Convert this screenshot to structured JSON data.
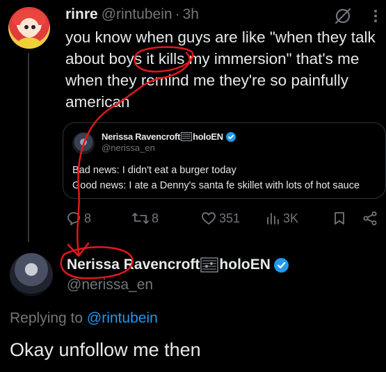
{
  "tweet": {
    "author_name": "rinre",
    "handle": "@rintubein",
    "separator": "·",
    "time": "3h",
    "text": "you know when guys are like \"when they talk about boys it kills my immersion\" that's me when they remind me they're so painfully american"
  },
  "quote": {
    "name_prefix": "Nerissa Ravencroft",
    "name_suffix": "holoEN",
    "handle": "@nerissa_en",
    "line1": "Bad news: I didn't eat a burger today",
    "line2": "Good news: I ate a Denny's santa fe skillet with lots of hot sauce"
  },
  "actions": {
    "replies": "8",
    "reposts": "8",
    "likes": "351",
    "views": "3K"
  },
  "reply": {
    "name_prefix": "Nerissa Ravencroft",
    "name_suffix": "holoEN",
    "handle": "@nerissa_en",
    "replying_prefix": "Replying to",
    "replying_to": "@rintubein",
    "text": "Okay unfollow me then"
  },
  "colors": {
    "background": "#000000",
    "text": "#e7e9ea",
    "muted": "#71767b",
    "link": "#1d9bf0",
    "verified": "#1d9bf0",
    "annotation": "#e5171d"
  },
  "icons": [
    "grok-icon",
    "more-icon",
    "reply-icon",
    "repost-icon",
    "like-icon",
    "views-icon",
    "bookmark-icon",
    "share-icon",
    "verified-badge-icon",
    "music-score-icon"
  ]
}
